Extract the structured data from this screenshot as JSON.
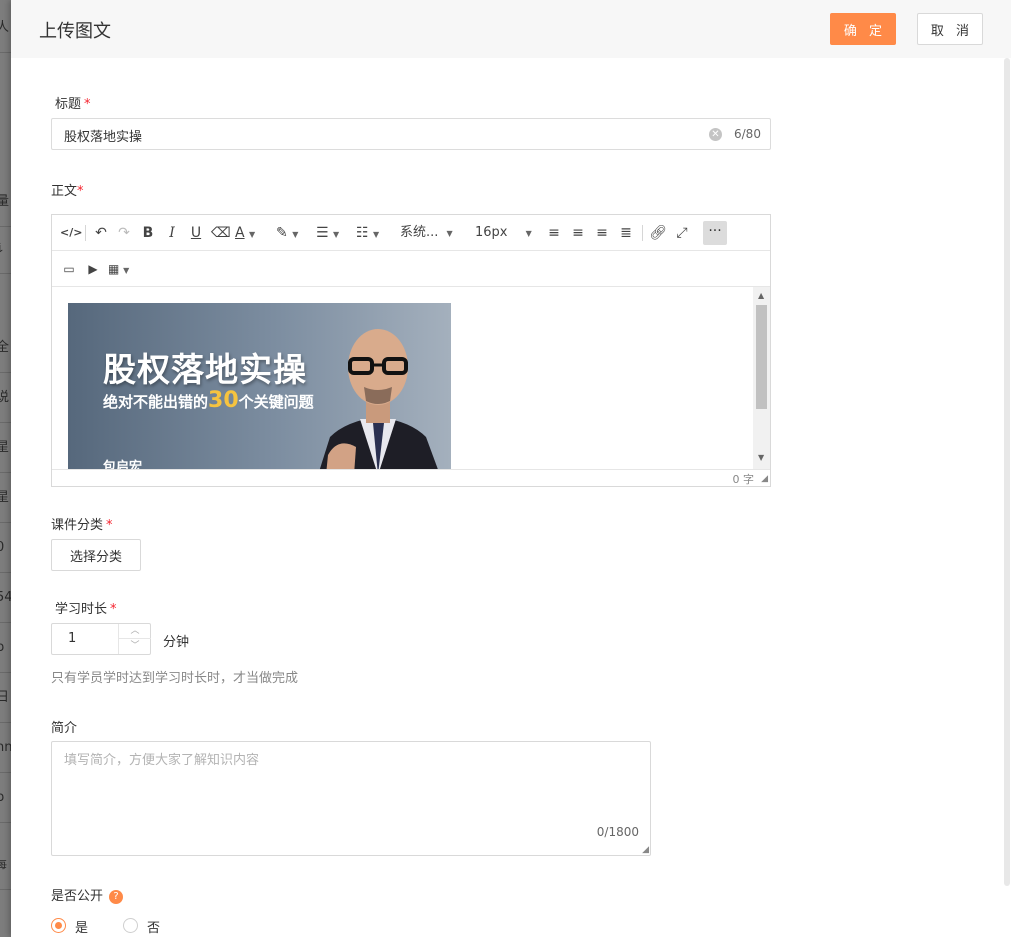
{
  "background_fragments": [
    "人",
    "量",
    "讠",
    "全",
    "说",
    "星",
    "星",
    "0",
    "54",
    "p",
    "日",
    "nn",
    "p",
    "每"
  ],
  "drawer": {
    "title": "上传图文",
    "ok_label": "确 定",
    "cancel_label": "取 消"
  },
  "form": {
    "title_label": "标题",
    "title_value": "股权落地实操",
    "title_count": "6/80",
    "body_label": "正文",
    "editor": {
      "font_family": "系统...",
      "font_size": "16px",
      "word_count": "0 字",
      "banner": {
        "headline": "股权落地实操",
        "sub_prefix": "绝对不能出错的",
        "sub_highlight": "30",
        "sub_suffix": "个关键问题",
        "author": "包启宏"
      }
    },
    "category_label": "课件分类",
    "category_button": "选择分类",
    "duration_label": "学习时长",
    "duration_value": "1",
    "duration_unit": "分钟",
    "duration_hint": "只有学员学时达到学习时长时，才当做完成",
    "intro_label": "简介",
    "intro_placeholder": "填写简介，方便大家了解知识内容",
    "intro_count": "0/1800",
    "public_label": "是否公开",
    "public_help": "?",
    "public_yes": "是",
    "public_no": "否",
    "public_selected": "是"
  },
  "colors": {
    "accent": "#ff8a48",
    "required": "#f5222d"
  }
}
